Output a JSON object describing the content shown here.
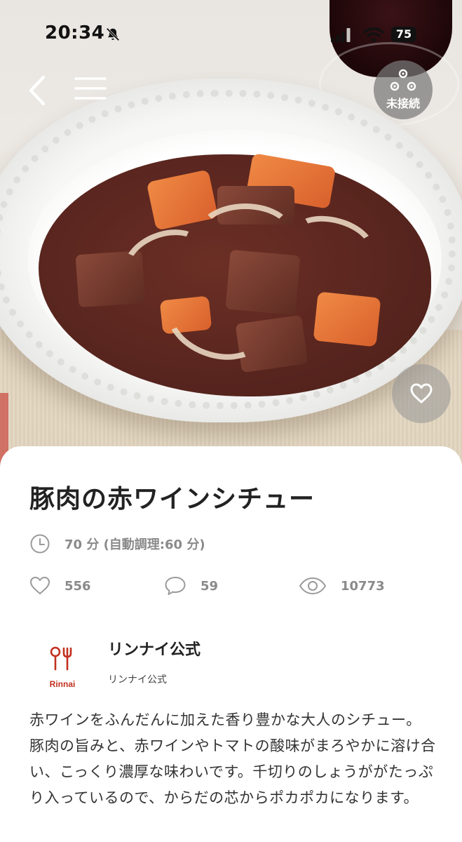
{
  "status_bar": {
    "time": "20:34",
    "battery": "75"
  },
  "header": {
    "connection_label": "未接続"
  },
  "recipe": {
    "title": "豚肉の赤ワインシチュー",
    "cook_time": "70 分 (自動調理:60 分)",
    "likes": "556",
    "comments": "59",
    "views": "10773",
    "description": "赤ワインをふんだんに加えた香り豊かな大人のシチュー。豚肉の旨みと、赤ワインやトマトの酸味がまろやかに溶け合い、こっくり濃厚な味わいです。千切りのしょうががたっぷり入っているので、からだの芯からポカポカになります。"
  },
  "author": {
    "name": "リンナイ公式",
    "subtitle": "リンナイ公式",
    "logo_text": "Rinnai"
  },
  "icons": {
    "back": "chevron-left-icon",
    "menu": "hamburger-menu-icon",
    "connection": "appliance-link-icon",
    "favorite": "heart-icon",
    "clock": "clock-icon",
    "likes": "heart-outline-icon",
    "comments": "speech-bubble-icon",
    "views": "eye-icon"
  },
  "colors": {
    "brand_red": "#c2301f",
    "meta_gray": "#8a8a8a",
    "icon_gray": "#9a9a9a"
  }
}
